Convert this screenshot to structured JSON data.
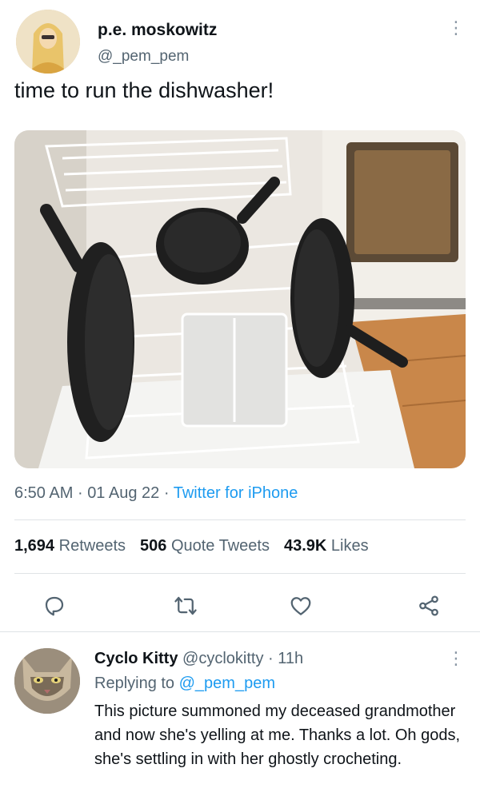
{
  "tweet": {
    "author_name": "p.e. moskowitz",
    "author_handle": "@_pem_pem",
    "text": "time to run the dishwasher!",
    "more_glyph": "⋮",
    "time": "6:50 AM",
    "separator": "·",
    "date": "01 Aug 22",
    "source": "Twitter for iPhone",
    "stats": {
      "retweets_count": "1,694",
      "retweets_label": "Retweets",
      "quotes_count": "506",
      "quotes_label": "Quote Tweets",
      "likes_count": "43.9K",
      "likes_label": "Likes"
    },
    "actions": [
      "reply-icon",
      "retweet-icon",
      "like-icon",
      "share-icon"
    ]
  },
  "reply": {
    "name": "Cyclo Kitty",
    "handle": "@cyclokitty",
    "separator": "·",
    "age": "11h",
    "replying_prefix": "Replying to",
    "replying_to": "@_pem_pem",
    "text": "This picture summoned my deceased grandmother and now she's yelling at me. Thanks a lot. Oh gods, she's settling in with her ghostly crocheting.",
    "more_glyph": "⋮"
  },
  "colors": {
    "text_primary": "#0f1419",
    "text_secondary": "#536471",
    "accent": "#1d9bf0",
    "divider": "#dfe3e6"
  }
}
